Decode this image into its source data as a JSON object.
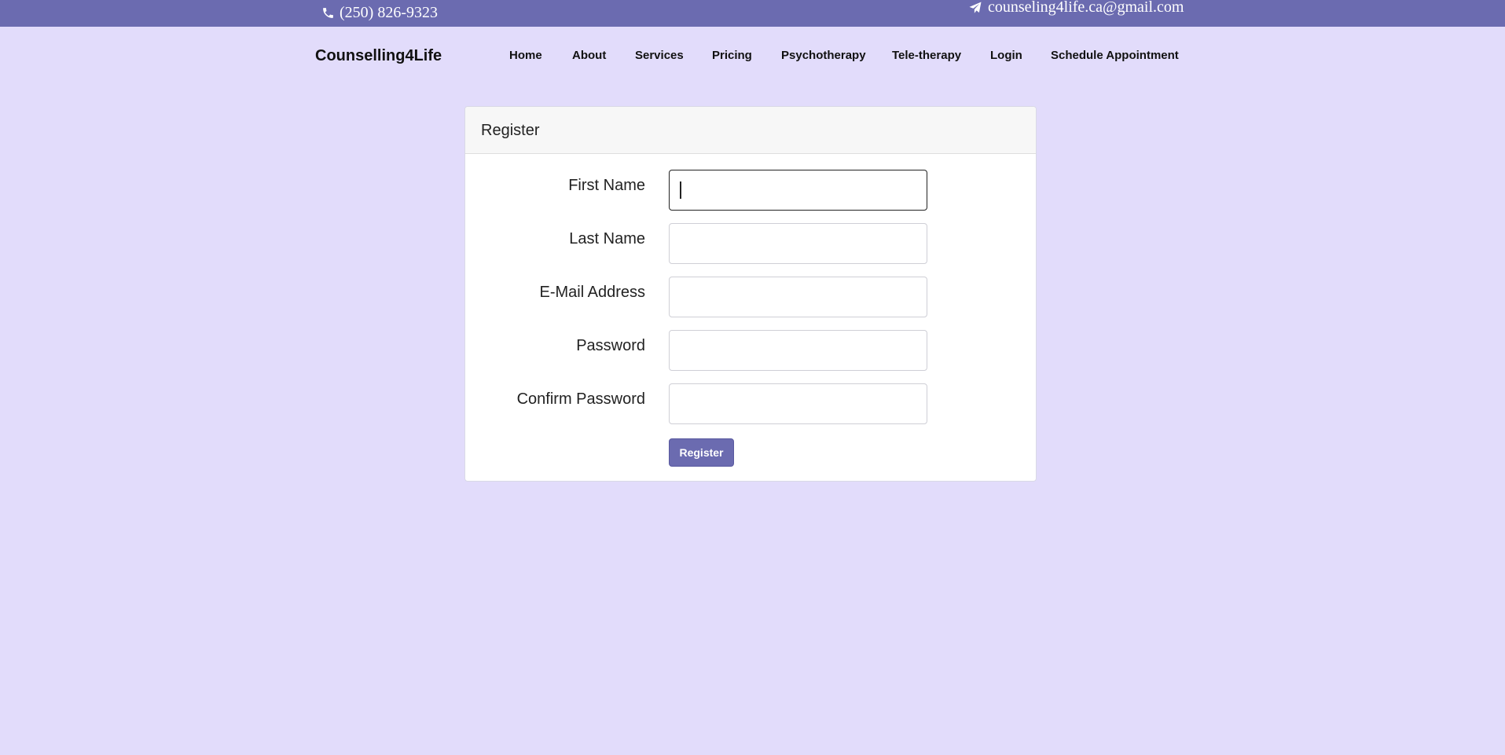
{
  "contact": {
    "phone": "(250) 826-9323",
    "email": "counseling4life.ca@gmail.com",
    "phone_icon": "phone-icon",
    "email_icon": "paper-plane-icon"
  },
  "brand": "Counselling4Life",
  "nav": {
    "items": [
      {
        "label": "Home"
      },
      {
        "label": "About"
      },
      {
        "label": "Services"
      },
      {
        "label": "Pricing"
      },
      {
        "label": "Psychotherapy"
      },
      {
        "label": "Tele-therapy"
      },
      {
        "label": "Login"
      },
      {
        "label": "Schedule Appointment"
      }
    ]
  },
  "register": {
    "title": "Register",
    "fields": [
      {
        "label": "First Name",
        "value": "",
        "focused": true
      },
      {
        "label": "Last Name",
        "value": ""
      },
      {
        "label": "E-Mail Address",
        "value": ""
      },
      {
        "label": "Password",
        "value": ""
      },
      {
        "label": "Confirm Password",
        "value": ""
      }
    ],
    "submit_label": "Register"
  },
  "colors": {
    "background": "#e2dcfb",
    "accent": "#6b6bb0",
    "card": "#ffffff"
  }
}
